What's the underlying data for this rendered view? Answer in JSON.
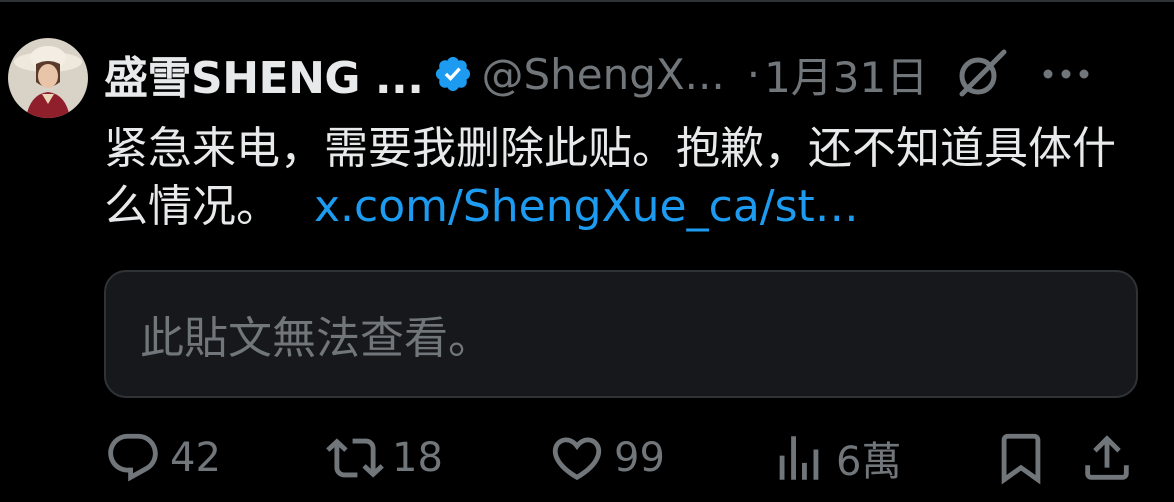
{
  "author": {
    "display_name": "盛雪SHENG ...",
    "handle": "@ShengX...",
    "separator": "·",
    "date": "1月31日",
    "verified_color": "#1d9bf0"
  },
  "icons": {
    "avatar": "avatar",
    "verified": "verified-badge-icon",
    "grok": "grok-icon",
    "more": "more-icon",
    "reply": "reply-icon",
    "repost": "repost-icon",
    "like": "heart-icon",
    "views": "views-icon",
    "bookmark": "bookmark-icon",
    "share": "share-icon"
  },
  "post": {
    "text": "紧急来电，需要我删除此贴。抱歉，还不知道具体什么情况。",
    "link": "x.com/ShengXue_ca/st…",
    "link_color": "#1d9bf0"
  },
  "quoted": {
    "unavailable_text": "此貼文無法查看。"
  },
  "metrics": {
    "replies": "42",
    "reposts": "18",
    "likes": "99",
    "views": "6萬"
  }
}
